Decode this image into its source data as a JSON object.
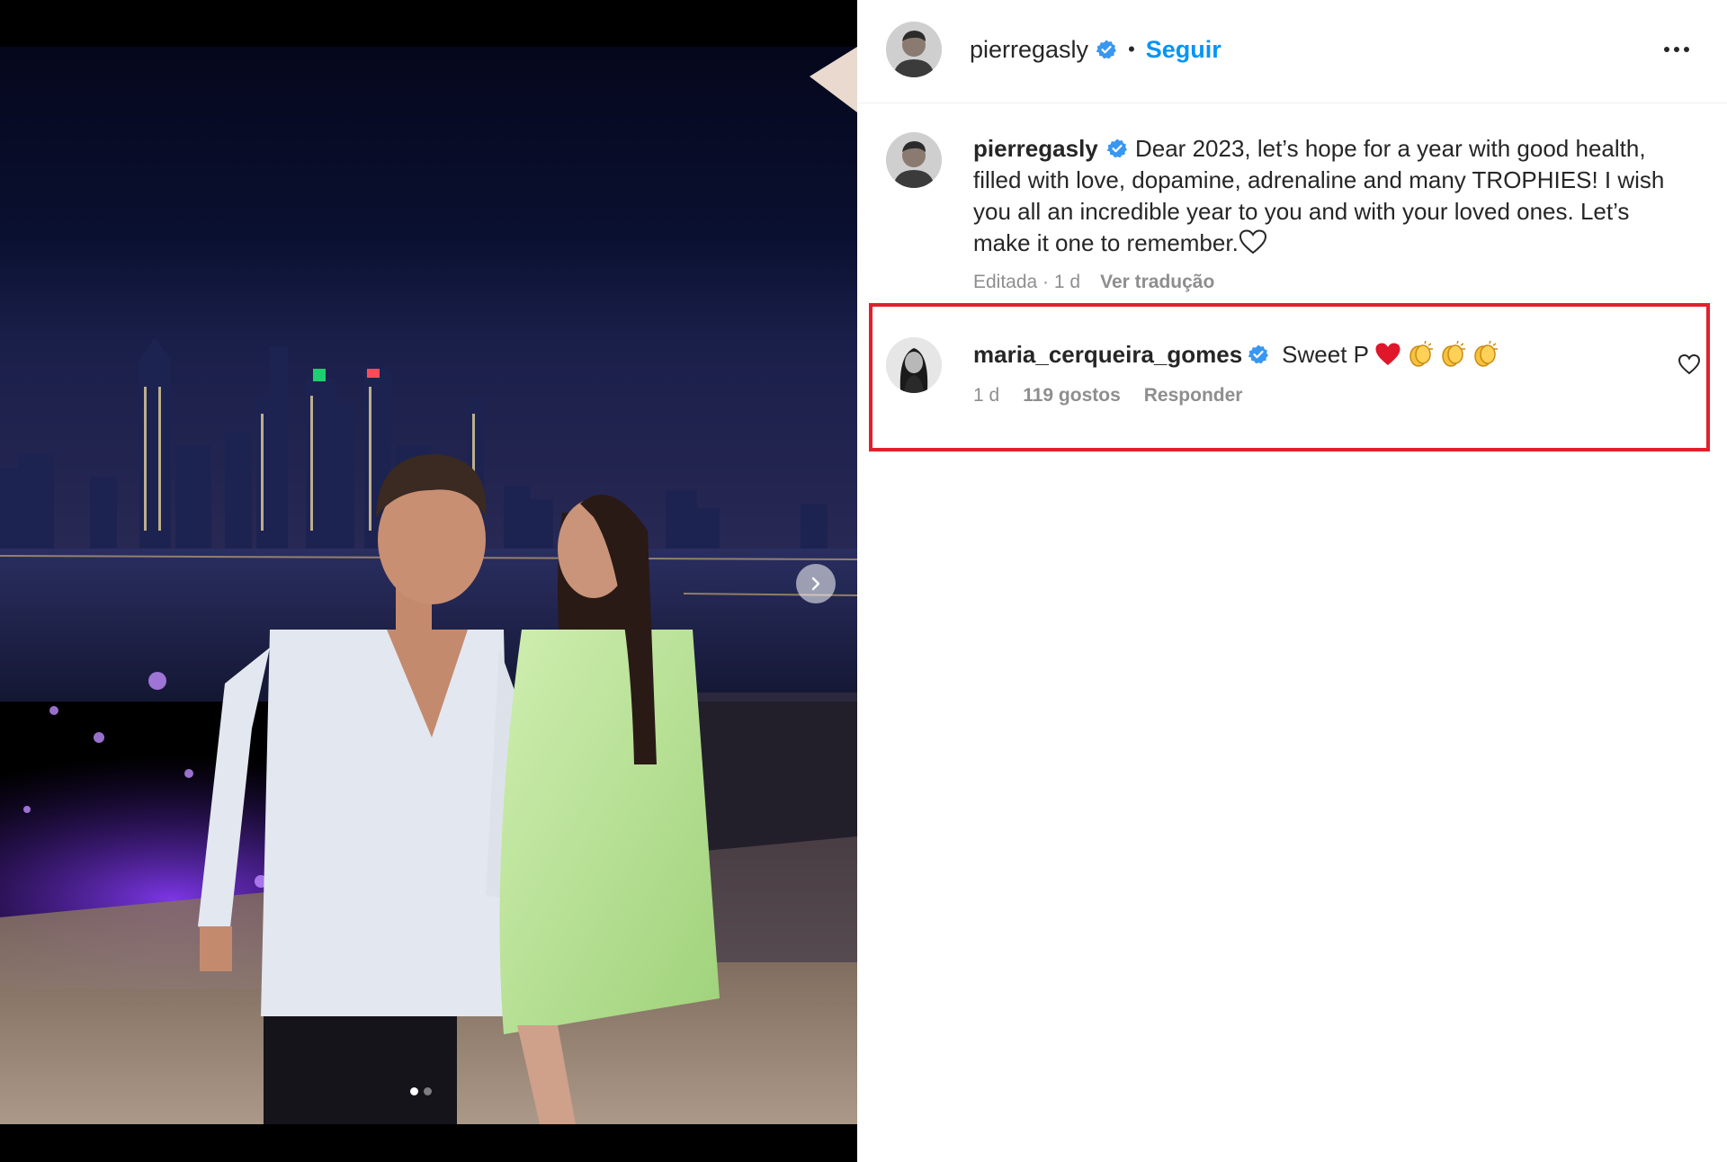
{
  "post": {
    "author": {
      "username": "pierregasly",
      "verified": true
    },
    "follow_label": "Seguir",
    "separator": "•",
    "more_icon": "more-horizontal-icon",
    "caption": {
      "username": "pierregasly",
      "text": "Dear 2023, let’s hope for a year with good health, filled with love, dopamine, adrenaline and many TROPHIES! I wish you all an incredible year to you and with your loved ones. Let’s make it one to remember."
    },
    "caption_meta": {
      "status": "Editada · 1 d",
      "translate_label": "Ver tradução"
    },
    "carousel": {
      "count": 2,
      "active": 1
    }
  },
  "comment": {
    "username": "maria_cerqueira_gomes",
    "verified": true,
    "text": "Sweet P",
    "emojis": [
      "red-heart-emoji",
      "clapping-hands-emoji",
      "clapping-hands-emoji",
      "clapping-hands-emoji"
    ],
    "time": "1 d",
    "likes": "119 gostos",
    "reply_label": "Responder",
    "highlighted": true
  },
  "colors": {
    "follow": "#0095f6",
    "verified": "#3897f0",
    "highlight_border": "#e2202c",
    "meta_text": "#8e8e8e"
  }
}
